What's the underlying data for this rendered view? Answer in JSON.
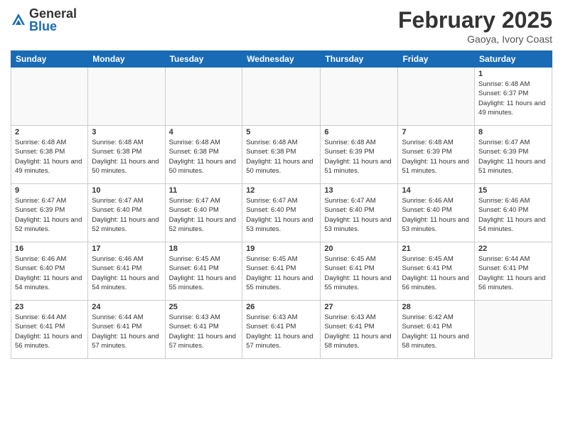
{
  "logo": {
    "general": "General",
    "blue": "Blue"
  },
  "title": "February 2025",
  "location": "Gaoya, Ivory Coast",
  "days_of_week": [
    "Sunday",
    "Monday",
    "Tuesday",
    "Wednesday",
    "Thursday",
    "Friday",
    "Saturday"
  ],
  "weeks": [
    [
      {
        "day": "",
        "info": ""
      },
      {
        "day": "",
        "info": ""
      },
      {
        "day": "",
        "info": ""
      },
      {
        "day": "",
        "info": ""
      },
      {
        "day": "",
        "info": ""
      },
      {
        "day": "",
        "info": ""
      },
      {
        "day": "1",
        "info": "Sunrise: 6:48 AM\nSunset: 6:37 PM\nDaylight: 11 hours and 49 minutes."
      }
    ],
    [
      {
        "day": "2",
        "info": "Sunrise: 6:48 AM\nSunset: 6:38 PM\nDaylight: 11 hours and 49 minutes."
      },
      {
        "day": "3",
        "info": "Sunrise: 6:48 AM\nSunset: 6:38 PM\nDaylight: 11 hours and 50 minutes."
      },
      {
        "day": "4",
        "info": "Sunrise: 6:48 AM\nSunset: 6:38 PM\nDaylight: 11 hours and 50 minutes."
      },
      {
        "day": "5",
        "info": "Sunrise: 6:48 AM\nSunset: 6:38 PM\nDaylight: 11 hours and 50 minutes."
      },
      {
        "day": "6",
        "info": "Sunrise: 6:48 AM\nSunset: 6:39 PM\nDaylight: 11 hours and 51 minutes."
      },
      {
        "day": "7",
        "info": "Sunrise: 6:48 AM\nSunset: 6:39 PM\nDaylight: 11 hours and 51 minutes."
      },
      {
        "day": "8",
        "info": "Sunrise: 6:47 AM\nSunset: 6:39 PM\nDaylight: 11 hours and 51 minutes."
      }
    ],
    [
      {
        "day": "9",
        "info": "Sunrise: 6:47 AM\nSunset: 6:39 PM\nDaylight: 11 hours and 52 minutes."
      },
      {
        "day": "10",
        "info": "Sunrise: 6:47 AM\nSunset: 6:40 PM\nDaylight: 11 hours and 52 minutes."
      },
      {
        "day": "11",
        "info": "Sunrise: 6:47 AM\nSunset: 6:40 PM\nDaylight: 11 hours and 52 minutes."
      },
      {
        "day": "12",
        "info": "Sunrise: 6:47 AM\nSunset: 6:40 PM\nDaylight: 11 hours and 53 minutes."
      },
      {
        "day": "13",
        "info": "Sunrise: 6:47 AM\nSunset: 6:40 PM\nDaylight: 11 hours and 53 minutes."
      },
      {
        "day": "14",
        "info": "Sunrise: 6:46 AM\nSunset: 6:40 PM\nDaylight: 11 hours and 53 minutes."
      },
      {
        "day": "15",
        "info": "Sunrise: 6:46 AM\nSunset: 6:40 PM\nDaylight: 11 hours and 54 minutes."
      }
    ],
    [
      {
        "day": "16",
        "info": "Sunrise: 6:46 AM\nSunset: 6:40 PM\nDaylight: 11 hours and 54 minutes."
      },
      {
        "day": "17",
        "info": "Sunrise: 6:46 AM\nSunset: 6:41 PM\nDaylight: 11 hours and 54 minutes."
      },
      {
        "day": "18",
        "info": "Sunrise: 6:45 AM\nSunset: 6:41 PM\nDaylight: 11 hours and 55 minutes."
      },
      {
        "day": "19",
        "info": "Sunrise: 6:45 AM\nSunset: 6:41 PM\nDaylight: 11 hours and 55 minutes."
      },
      {
        "day": "20",
        "info": "Sunrise: 6:45 AM\nSunset: 6:41 PM\nDaylight: 11 hours and 55 minutes."
      },
      {
        "day": "21",
        "info": "Sunrise: 6:45 AM\nSunset: 6:41 PM\nDaylight: 11 hours and 56 minutes."
      },
      {
        "day": "22",
        "info": "Sunrise: 6:44 AM\nSunset: 6:41 PM\nDaylight: 11 hours and 56 minutes."
      }
    ],
    [
      {
        "day": "23",
        "info": "Sunrise: 6:44 AM\nSunset: 6:41 PM\nDaylight: 11 hours and 56 minutes."
      },
      {
        "day": "24",
        "info": "Sunrise: 6:44 AM\nSunset: 6:41 PM\nDaylight: 11 hours and 57 minutes."
      },
      {
        "day": "25",
        "info": "Sunrise: 6:43 AM\nSunset: 6:41 PM\nDaylight: 11 hours and 57 minutes."
      },
      {
        "day": "26",
        "info": "Sunrise: 6:43 AM\nSunset: 6:41 PM\nDaylight: 11 hours and 57 minutes."
      },
      {
        "day": "27",
        "info": "Sunrise: 6:43 AM\nSunset: 6:41 PM\nDaylight: 11 hours and 58 minutes."
      },
      {
        "day": "28",
        "info": "Sunrise: 6:42 AM\nSunset: 6:41 PM\nDaylight: 11 hours and 58 minutes."
      },
      {
        "day": "",
        "info": ""
      }
    ]
  ]
}
